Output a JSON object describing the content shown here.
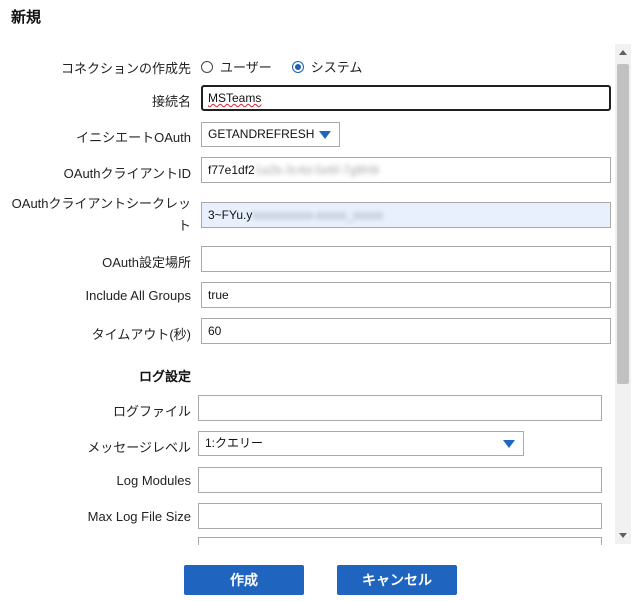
{
  "dialog": {
    "title": "新規"
  },
  "form": {
    "connection_type": {
      "label": "コネクションの作成先",
      "options": [
        "ユーザー",
        "システム"
      ],
      "selected": "システム"
    },
    "connection_name": {
      "label": "接続名",
      "value": "MSTeams"
    },
    "initiate_oauth": {
      "label": "イニシエートOAuth",
      "value": "GETANDREFRESH"
    },
    "oauth_client_id": {
      "label": "OAuthクライアントID",
      "visible_prefix": "f77e1df2",
      "masked": "1a2b-3c4d-5e6f-7g8h9i"
    },
    "oauth_client_secret": {
      "label": "OAuthクライアントシークレット",
      "visible_prefix": "3~FYu.y",
      "masked": "xxxxxxxxxx-xxxxx_xxxxx"
    },
    "oauth_settings_location": {
      "label": "OAuth設定場所",
      "value": ""
    },
    "include_all_groups": {
      "label": "Include All Groups",
      "value": "true"
    },
    "timeout": {
      "label": "タイムアウト(秒)",
      "value": "60"
    }
  },
  "log_settings": {
    "heading": "ログ設定",
    "logfile": {
      "label": "ログファイル",
      "value": ""
    },
    "verbosity": {
      "label": "メッセージレベル",
      "value": "1:クエリー"
    },
    "log_modules": {
      "label": "Log Modules",
      "value": ""
    },
    "max_log_file_size": {
      "label": "Max Log File Size",
      "value": ""
    }
  },
  "buttons": {
    "create": "作成",
    "cancel": "キャンセル"
  },
  "colors": {
    "accent": "#1f65c0",
    "autofill": "#e8f0fe"
  }
}
